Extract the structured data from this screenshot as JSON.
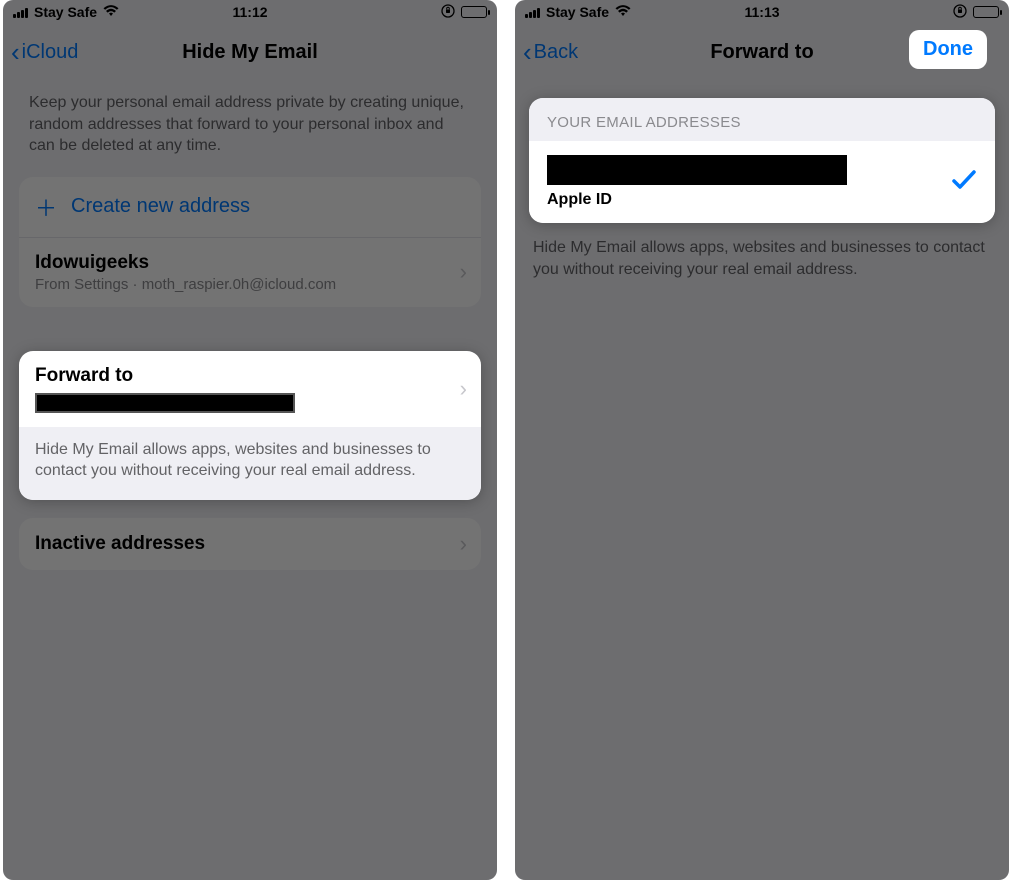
{
  "phone1": {
    "status": {
      "carrier": "Stay Safe",
      "time": "11:12"
    },
    "nav": {
      "back": "iCloud",
      "title": "Hide My Email"
    },
    "intro": "Keep your personal email address private by creating unique, random addresses that forward to your personal inbox and can be deleted at any time.",
    "create_label": "Create new address",
    "item": {
      "title": "Idowuigeeks",
      "sub": "From Settings · moth_raspier.0h@icloud.com"
    },
    "forward": {
      "title": "Forward to",
      "footer": "Hide My Email allows apps, websites and businesses to contact you without receiving your real email address."
    },
    "inactive_label": "Inactive addresses"
  },
  "phone2": {
    "status": {
      "carrier": "Stay Safe",
      "time": "11:13"
    },
    "nav": {
      "back": "Back",
      "title": "Forward to",
      "done": "Done"
    },
    "section_header": "YOUR EMAIL ADDRESSES",
    "email_sub": "Apple ID",
    "desc": "Hide My Email allows apps, websites and businesses to contact you without receiving your real email address."
  }
}
